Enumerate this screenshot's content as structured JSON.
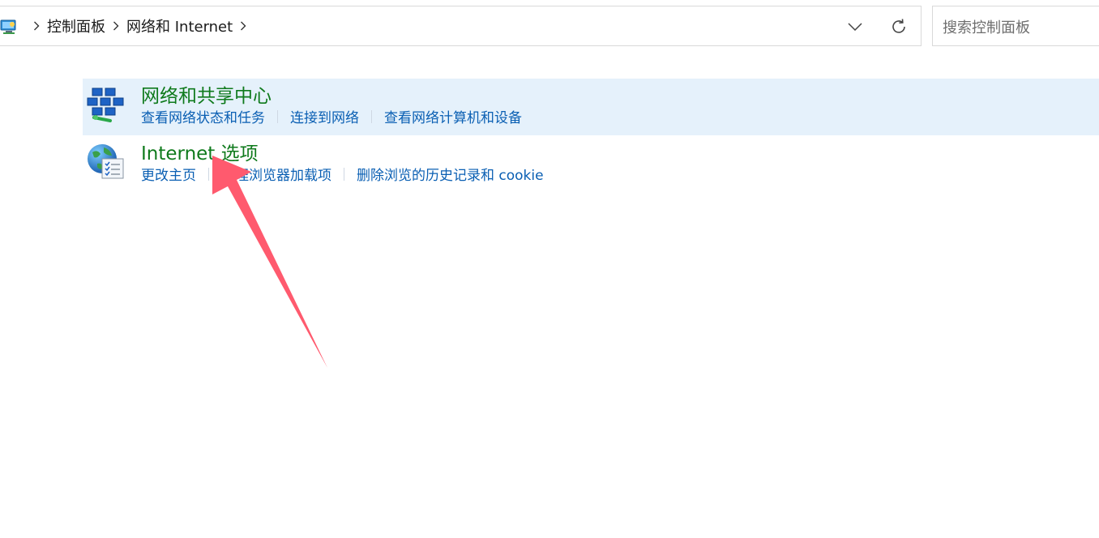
{
  "address_bar": {
    "breadcrumbs": [
      {
        "label": "控制面板"
      },
      {
        "label": "网络和 Internet"
      }
    ]
  },
  "search": {
    "placeholder": "搜索控制面板"
  },
  "categories": [
    {
      "title": "网络和共享中心",
      "selected": true,
      "icon": "network-sharing-icon",
      "links": [
        "查看网络状态和任务",
        "连接到网络",
        "查看网络计算机和设备"
      ]
    },
    {
      "title": "Internet 选项",
      "selected": false,
      "icon": "internet-options-icon",
      "links": [
        "更改主页",
        "管理浏览器加载项",
        "删除浏览的历史记录和 cookie"
      ]
    }
  ],
  "colors": {
    "title_green": "#0f7a1c",
    "link_blue": "#0a5fb3",
    "selected_bg": "#e5f1fb",
    "annotation_arrow": "#ff5a6e"
  }
}
